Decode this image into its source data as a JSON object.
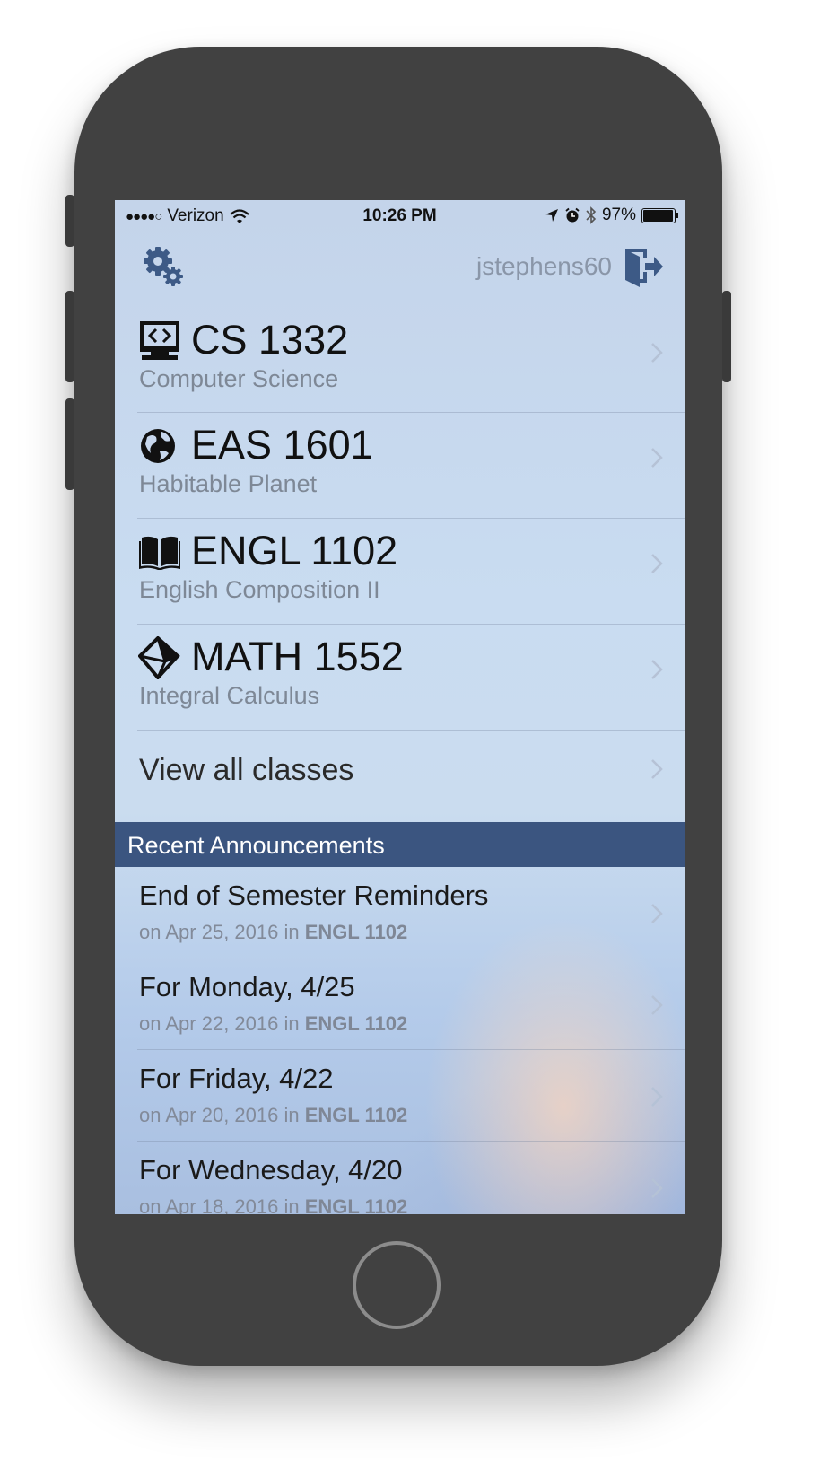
{
  "status_bar": {
    "signal_dots": "●●●●○",
    "carrier": "Verizon",
    "time": "10:26 PM",
    "battery_percent": "97%",
    "battery_level": 0.97
  },
  "nav": {
    "settings_icon": "gears-icon",
    "username": "jstephens60",
    "logout_icon": "logout-door-icon"
  },
  "courses": [
    {
      "code": "CS 1332",
      "name": "Computer Science",
      "icon": "computer-code-icon"
    },
    {
      "code": "EAS 1601",
      "name": "Habitable Planet",
      "icon": "globe-icon"
    },
    {
      "code": "ENGL 1102",
      "name": "English Composition II",
      "icon": "book-icon"
    },
    {
      "code": "MATH 1552",
      "name": "Integral Calculus",
      "icon": "geometry-solid-icon"
    }
  ],
  "view_all_label": "View all classes",
  "announcements_header": "Recent Announcements",
  "announcements": [
    {
      "title": "End of Semester Reminders",
      "prefix": "on Apr 25, 2016 in",
      "course": "ENGL 1102"
    },
    {
      "title": "For Monday, 4/25",
      "prefix": "on Apr 22, 2016 in",
      "course": "ENGL 1102"
    },
    {
      "title": "For Friday, 4/22",
      "prefix": "on Apr 20, 2016 in",
      "course": "ENGL 1102"
    },
    {
      "title": "For Wednesday, 4/20",
      "prefix": "on Apr 18, 2016 in",
      "course": "ENGL 1102"
    }
  ],
  "colors": {
    "header_bar": "#3b5580",
    "icon_blue": "#3d5a86",
    "device_body": "#414141"
  }
}
